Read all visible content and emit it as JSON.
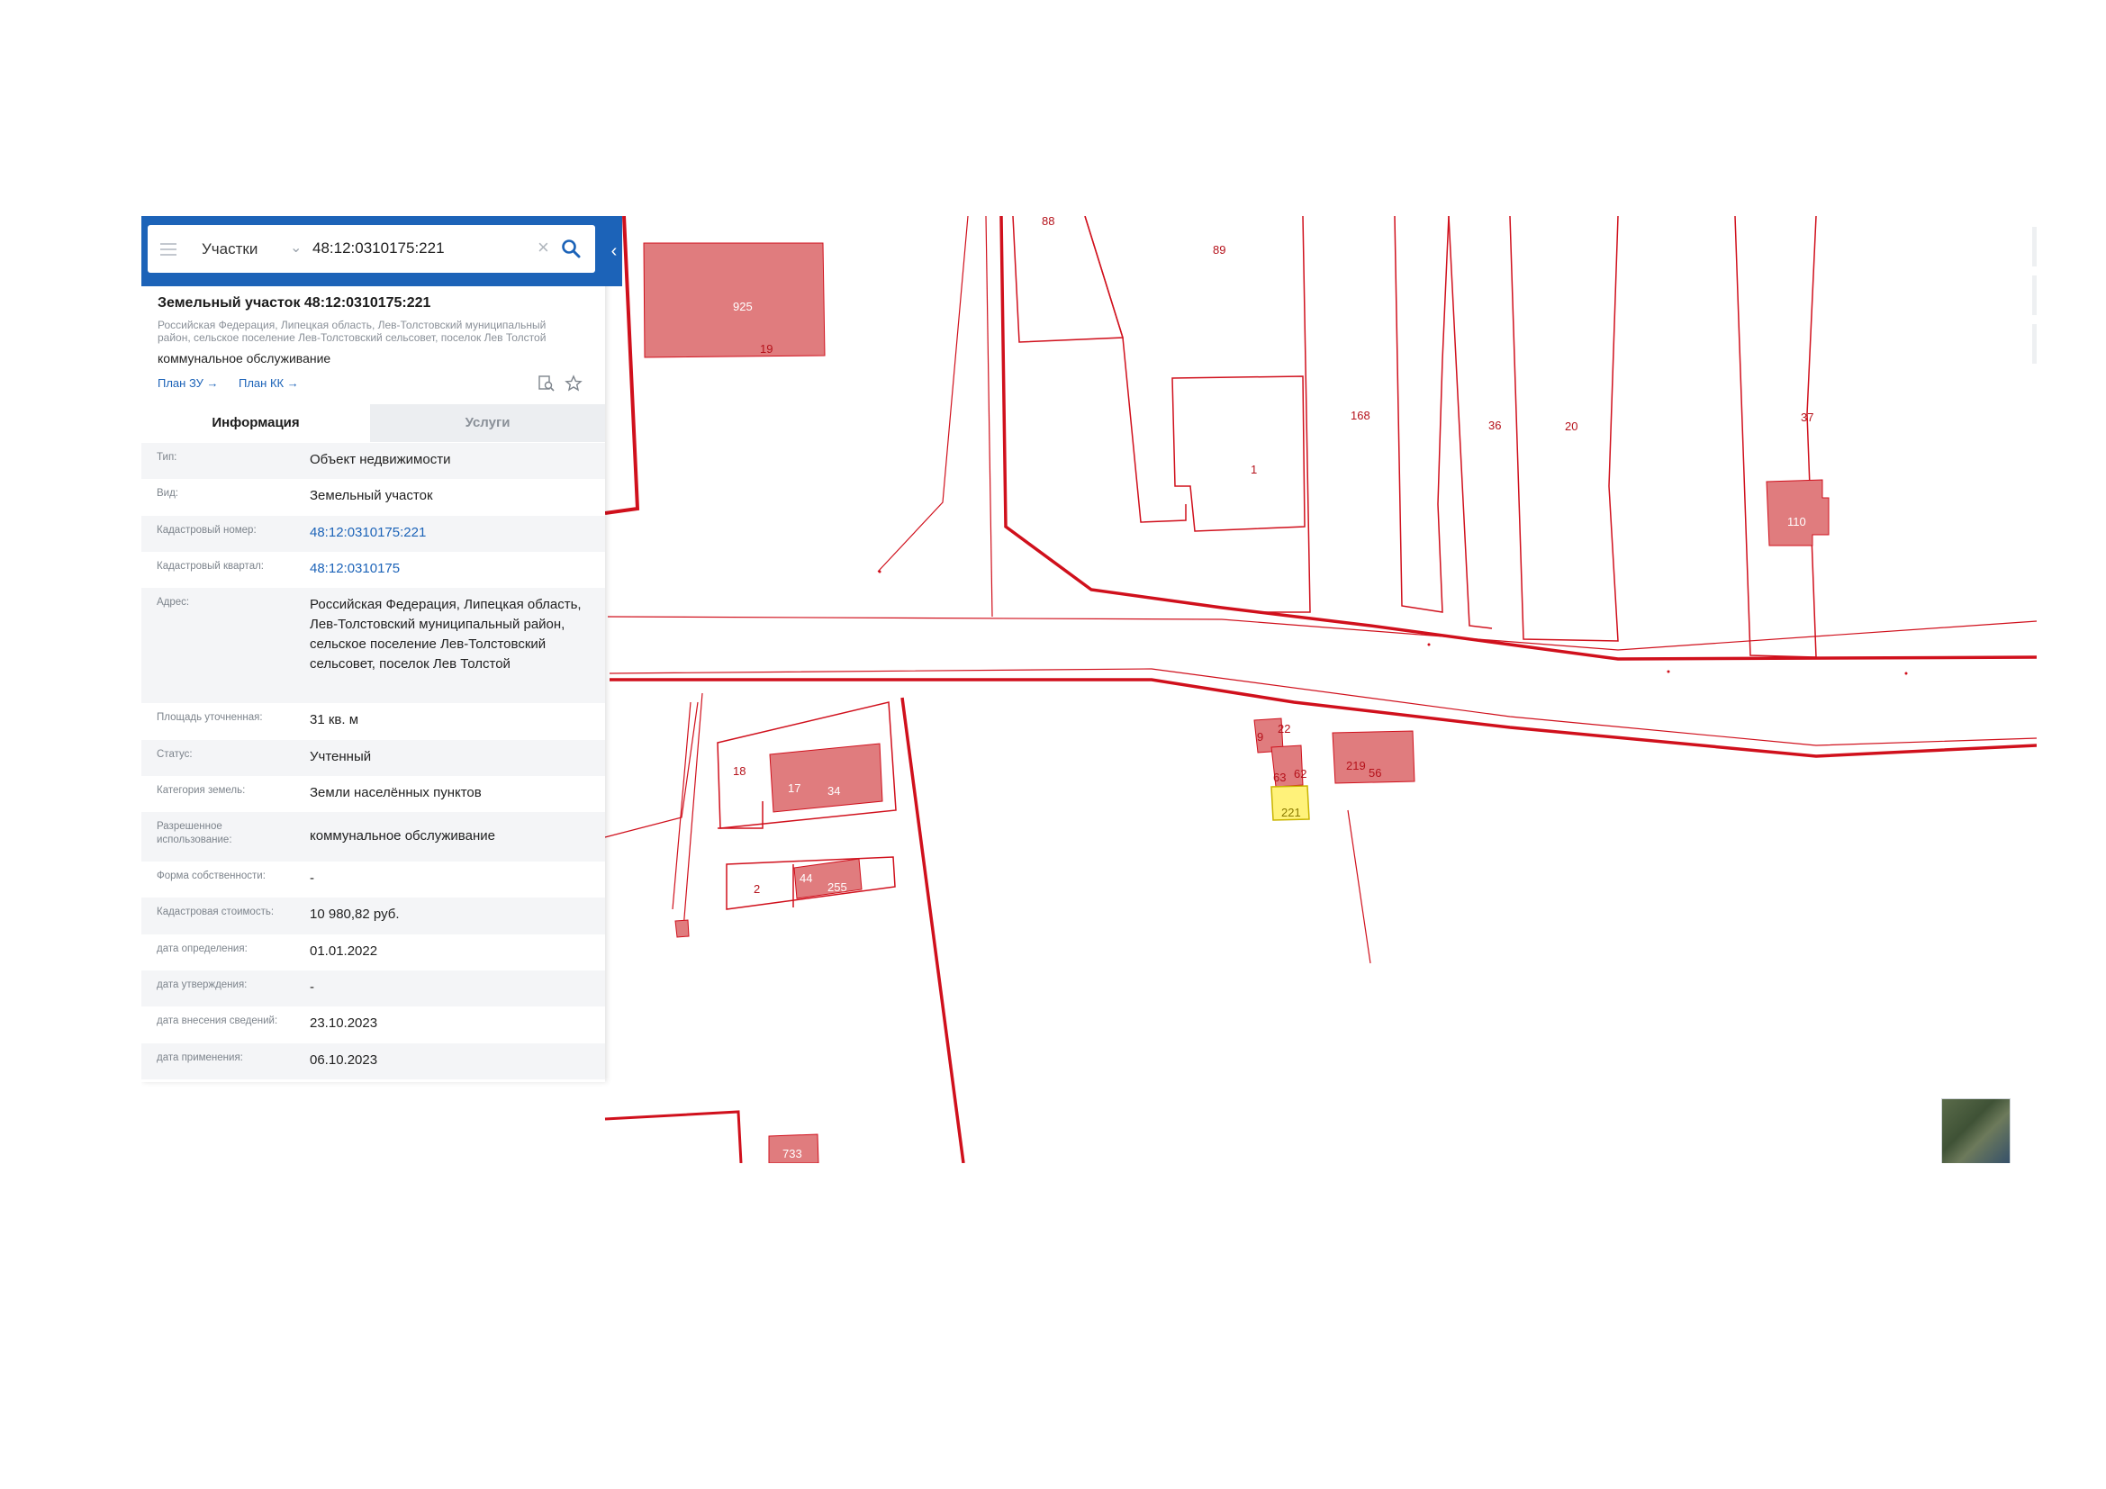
{
  "search": {
    "layer": "Участки",
    "query": "48:12:0310175:221"
  },
  "object": {
    "title": "Земельный участок 48:12:0310175:221",
    "address": "Российская Федерация, Липецкая область, Лев-Толстовский муниципальный район, сельское поселение Лев-Толстовский сельсовет, поселок Лев Толстой",
    "usage": "коммунальное обслуживание",
    "link_plan_zu": "План ЗУ →",
    "link_plan_kk": "План КК →"
  },
  "tabs": {
    "info": "Информация",
    "services": "Услуги"
  },
  "properties": [
    {
      "key": "Тип:",
      "value": "Объект недвижимости"
    },
    {
      "key": "Вид:",
      "value": "Земельный участок"
    },
    {
      "key": "Кадастровый номер:",
      "value": "48:12:0310175:221",
      "link": true
    },
    {
      "key": "Кадастровый квартал:",
      "value": "48:12:0310175",
      "link": true
    },
    {
      "key": "Адрес:",
      "value": "Российская Федерация, Липецкая область, Лев-Толстовский муниципальный район, сельское поселение Лев-Толстовский сельсовет, поселок Лев Толстой"
    },
    {
      "key": "Площадь уточненная:",
      "value": "31 кв. м"
    },
    {
      "key": "Статус:",
      "value": "Учтенный"
    },
    {
      "key": "Категория земель:",
      "value": "Земли населённых пунктов"
    },
    {
      "key": "Разрешенное использование:",
      "value": "коммунальное обслуживание"
    },
    {
      "key": "Форма собственности:",
      "value": "-"
    },
    {
      "key": "Кадастровая стоимость:",
      "value": "10 980,82 руб."
    },
    {
      "key": "дата определения:",
      "value": "01.01.2022"
    },
    {
      "key": "дата утверждения:",
      "value": "-"
    },
    {
      "key": "дата внесения сведений:",
      "value": "23.10.2023"
    },
    {
      "key": "дата применения:",
      "value": "06.10.2023"
    }
  ],
  "map": {
    "parcel_labels": [
      "88",
      "89",
      "925",
      "19",
      "168",
      "36",
      "20",
      "37",
      "1",
      "110",
      "18",
      "17",
      "34",
      "2",
      "44",
      "255",
      "9",
      "22",
      "63",
      "62",
      "219",
      "56",
      "221",
      "733"
    ],
    "colors": {
      "boundary": "#d0101c",
      "building_fill": "#e07c7e",
      "selected_fill": "#fff27a",
      "panel_blue": "#1c63b8"
    }
  }
}
